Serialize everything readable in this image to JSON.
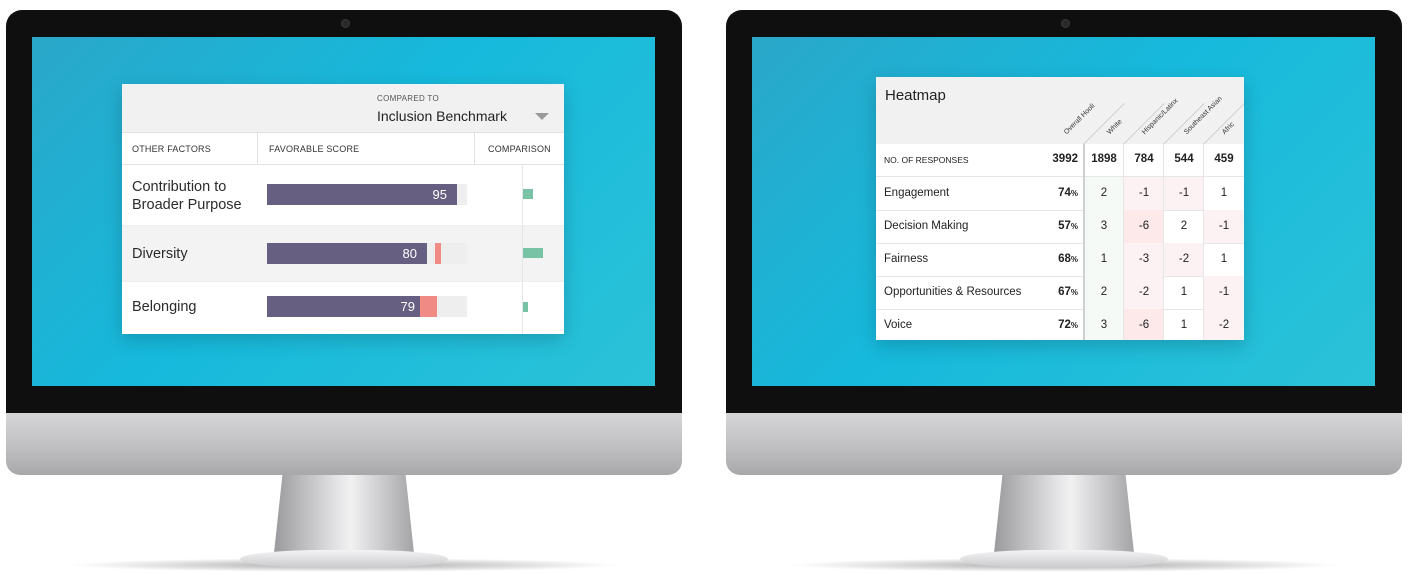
{
  "left_panel": {
    "compare_caption": "COMPARED TO",
    "compare_value": "Inclusion Benchmark",
    "columns": [
      "OTHER FACTORS",
      "FAVORABLE SCORE",
      "COMPARISON"
    ],
    "rows": [
      {
        "label_line1": "Contribution to",
        "label_line2": "Broader Purpose",
        "score": 95,
        "benchmark": 95,
        "comparison": 2
      },
      {
        "label_line1": "Diversity",
        "label_line2": "",
        "score": 80,
        "benchmark": 87,
        "comparison": 4
      },
      {
        "label_line1": "Belonging",
        "label_line2": "",
        "score": 79,
        "benchmark": 85,
        "comparison": 1
      }
    ],
    "colors": {
      "bar": "#675f82",
      "marker": "#ef8a85",
      "comparison": "#78c3a5"
    }
  },
  "right_panel": {
    "title": "Heatmap",
    "columns": [
      "Overall Hooli",
      "White",
      "Hispanic/Latinx",
      "Southeast Asian",
      "Afric"
    ],
    "responses_label": "NO. OF RESPONSES",
    "responses": [
      "3992",
      "1898",
      "784",
      "544",
      "459"
    ],
    "rows": [
      {
        "label": "Engagement",
        "overall": "74",
        "values": [
          "2",
          "-1",
          "-1",
          "1"
        ]
      },
      {
        "label": "Decision Making",
        "overall": "57",
        "values": [
          "3",
          "-6",
          "2",
          "-1"
        ]
      },
      {
        "label": "Fairness",
        "overall": "68",
        "values": [
          "1",
          "-3",
          "-2",
          "1"
        ]
      },
      {
        "label": "Opportunities & Resources",
        "overall": "67",
        "values": [
          "2",
          "-2",
          "1",
          "-1"
        ]
      },
      {
        "label": "Voice",
        "overall": "72",
        "values": [
          "3",
          "-6",
          "1",
          "-2"
        ]
      }
    ],
    "pct_suffix": "%",
    "colors": {
      "negative_strong": "#fde8ea",
      "negative": "#fdf2f3",
      "positive": "#f6faf6"
    }
  }
}
